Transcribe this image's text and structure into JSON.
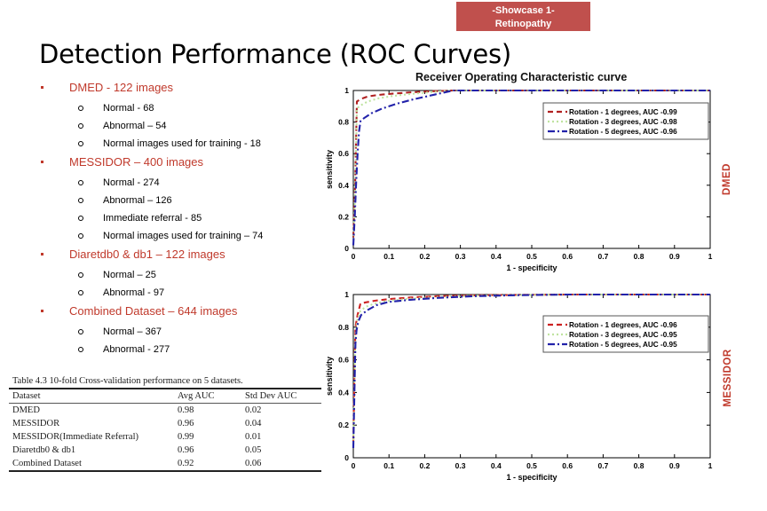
{
  "banner": {
    "line1": "-Showcase 1-",
    "line2": "Retinopathy",
    "color": "#c0504d"
  },
  "title": "Detection Performance (ROC Curves)",
  "bullets": [
    {
      "label": "DMED  - 122 images",
      "sub": [
        "Normal - 68",
        "Abnormal – 54",
        "Normal images used for training - 18"
      ]
    },
    {
      "label": "MESSIDOR – 400 images",
      "sub": [
        "Normal - 274",
        "Abnormal – 126",
        "Immediate referral -  85",
        "Normal images used for training – 74"
      ]
    },
    {
      "label": "Diaretdb0 & db1 – 122 images",
      "sub": [
        "Normal – 25",
        "Abnormal - 97"
      ]
    },
    {
      "label": "Combined Dataset – 644 images",
      "sub": [
        "Normal –  367",
        "Abnormal - 277"
      ]
    }
  ],
  "results_table": {
    "caption": "Table 4.3 10-fold Cross-validation performance on 5 datasets.",
    "headers": [
      "Dataset",
      "Avg AUC",
      "Std Dev AUC"
    ],
    "rows": [
      [
        "DMED",
        "0.98",
        "0.02"
      ],
      [
        "MESSIDOR",
        "0.96",
        "0.04"
      ],
      [
        "MESSIDOR(Immediate Referral)",
        "0.99",
        "0.01"
      ],
      [
        "Diaretdb0 & db1",
        "0.96",
        "0.05"
      ],
      [
        "Combined Dataset",
        "0.92",
        "0.06"
      ]
    ]
  },
  "roc_title": "Receiver Operating Characteristic curve",
  "side_labels": {
    "top": "DMED",
    "bottom": "MESSIDOR"
  },
  "chart_data": [
    {
      "id": "dmed",
      "type": "line",
      "title": "Receiver Operating Characteristic curve",
      "xlabel": "1 - specificity",
      "ylabel": "sensitivity",
      "xlim": [
        0,
        1
      ],
      "ylim": [
        0,
        1
      ],
      "xticks": [
        "0",
        "0.1",
        "0.2",
        "0.3",
        "0.4",
        "0.5",
        "0.6",
        "0.7",
        "0.8",
        "0.9",
        "1"
      ],
      "yticks": [
        "0",
        "0.2",
        "0.4",
        "0.6",
        "0.8",
        "1"
      ],
      "grid": false,
      "legend_position": "upper right",
      "series": [
        {
          "name": "Rotation - 1 degrees, AUC -0.99",
          "color": "#b02020",
          "dash": "dashed",
          "auc": 0.99,
          "x": [
            0,
            0.005,
            0.01,
            0.02,
            0.04,
            0.07,
            0.11,
            0.16,
            0.22,
            0.28,
            0.45,
            0.7,
            1
          ],
          "y": [
            0.07,
            0.4,
            0.93,
            0.945,
            0.962,
            0.972,
            0.98,
            0.988,
            0.995,
            1,
            1,
            1,
            1
          ]
        },
        {
          "name": "Rotation - 3 degrees, AUC -0.98",
          "color": "#bfe3a0",
          "dash": "dotted",
          "auc": 0.98,
          "x": [
            0,
            0.005,
            0.01,
            0.02,
            0.04,
            0.07,
            0.11,
            0.16,
            0.22,
            0.28,
            0.45,
            0.7,
            1
          ],
          "y": [
            0.05,
            0.35,
            0.885,
            0.905,
            0.93,
            0.95,
            0.965,
            0.978,
            0.99,
            1,
            1,
            1,
            1
          ]
        },
        {
          "name": "Rotation - 5 degrees, AUC -0.96",
          "color": "#2222aa",
          "dash": "dashdot",
          "auc": 0.96,
          "x": [
            0,
            0.004,
            0.008,
            0.012,
            0.016,
            0.02,
            0.03,
            0.05,
            0.08,
            0.12,
            0.17,
            0.23,
            0.28,
            0.5,
            1
          ],
          "y": [
            0.02,
            0.2,
            0.42,
            0.6,
            0.74,
            0.805,
            0.825,
            0.855,
            0.885,
            0.915,
            0.945,
            0.975,
            1,
            1,
            1
          ]
        }
      ]
    },
    {
      "id": "messidor",
      "type": "line",
      "title": "Receiver Operating Characteristic curve",
      "xlabel": "1 - specificity",
      "ylabel": "sensitivity",
      "xlim": [
        0,
        1
      ],
      "ylim": [
        0,
        1
      ],
      "xticks": [
        "0",
        "0.1",
        "0.2",
        "0.3",
        "0.4",
        "0.5",
        "0.6",
        "0.7",
        "0.8",
        "0.9",
        "1"
      ],
      "yticks": [
        "0",
        "0.2",
        "0.4",
        "0.6",
        "0.8",
        "1"
      ],
      "grid": false,
      "legend_position": "upper right",
      "series": [
        {
          "name": "Rotation - 1 degrees, AUC -0.96",
          "color": "#cc2222",
          "dash": "dashed",
          "auc": 0.96,
          "x": [
            0,
            0.002,
            0.004,
            0.006,
            0.009,
            0.012,
            0.02,
            0.035,
            0.06,
            0.1,
            0.16,
            0.24,
            0.34,
            0.46,
            0.6,
            0.8,
            1
          ],
          "y": [
            0.1,
            0.35,
            0.62,
            0.8,
            0.84,
            0.875,
            0.945,
            0.952,
            0.962,
            0.972,
            0.982,
            0.99,
            0.995,
            0.998,
            1,
            1,
            1
          ]
        },
        {
          "name": "Rotation - 3 degrees, AUC -0.95",
          "color": "#bfe3a0",
          "dash": "dotted",
          "auc": 0.95,
          "x": [
            0,
            0.002,
            0.004,
            0.006,
            0.009,
            0.012,
            0.02,
            0.035,
            0.06,
            0.1,
            0.16,
            0.24,
            0.34,
            0.46,
            0.6,
            0.8,
            1
          ],
          "y": [
            0.08,
            0.3,
            0.56,
            0.74,
            0.81,
            0.855,
            0.9,
            0.925,
            0.945,
            0.962,
            0.975,
            0.985,
            0.993,
            0.997,
            1,
            1,
            1
          ]
        },
        {
          "name": "Rotation - 5 degrees, AUC -0.95",
          "color": "#2222aa",
          "dash": "dashdot",
          "auc": 0.95,
          "x": [
            0,
            0.002,
            0.004,
            0.006,
            0.009,
            0.014,
            0.022,
            0.04,
            0.065,
            0.1,
            0.16,
            0.24,
            0.34,
            0.46,
            0.6,
            0.8,
            1
          ],
          "y": [
            0.06,
            0.28,
            0.5,
            0.7,
            0.78,
            0.835,
            0.875,
            0.905,
            0.935,
            0.955,
            0.968,
            0.98,
            0.99,
            0.996,
            1,
            1,
            1
          ]
        }
      ]
    }
  ]
}
